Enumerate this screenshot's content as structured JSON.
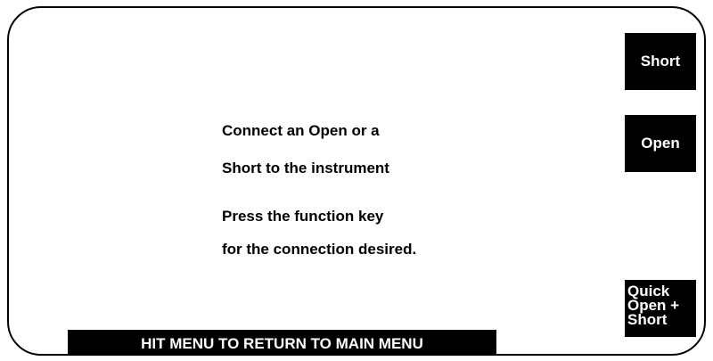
{
  "instructions": {
    "line1": "Connect an Open or a",
    "line2": "Short to the instrument",
    "line3": "Press the function key",
    "line4": "for the connection desired."
  },
  "softkeys": {
    "short_label": "Short",
    "open_label": "Open",
    "quick_line1": "Quick",
    "quick_line2": "Open +",
    "quick_line3": "Short"
  },
  "status_bar": {
    "text": "HIT MENU TO RETURN TO MAIN MENU"
  },
  "colors": {
    "background": "#ffffff",
    "foreground": "#000000",
    "key_background": "#000000",
    "key_text": "#ffffff"
  }
}
